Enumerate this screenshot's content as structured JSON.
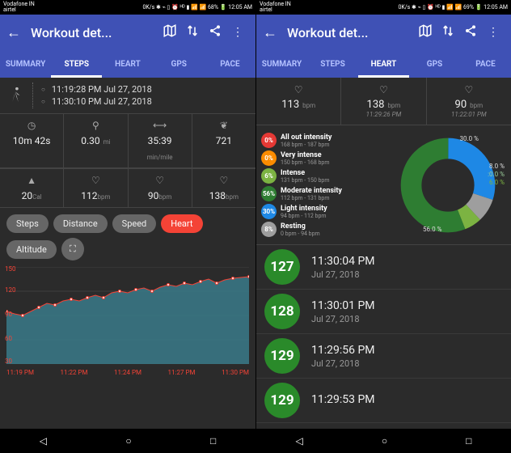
{
  "status": {
    "left_carrier": "Vodafone IN\nairtel",
    "left_icons": "0K/s ✱ ⌁ ▯ ⏰ ᴴᴰ ▮ 📶 📶 68% 🔋 12:05 AM",
    "right_icons": "0K/s ✱ ⌁ ▯ ⏰ ᴴᴰ ▮ 📶 📶 69% 🔋 12:05 AM"
  },
  "appbar": {
    "title": "Workout det...",
    "icons": {
      "map": "⌖",
      "updown": "↑↓",
      "share": "<",
      "more": "⋮"
    }
  },
  "tabs": {
    "items": [
      "SUMMARY",
      "STEPS",
      "HEART",
      "GPS",
      "PACE"
    ],
    "active_left": 1,
    "active_right": 2
  },
  "left": {
    "start_time": "11:19:28 PM Jul 27, 2018",
    "end_time": "11:30:10 PM Jul 27, 2018",
    "stats1": [
      {
        "icon": "⏱",
        "val": "10m 42s",
        "unit": ""
      },
      {
        "icon": "📍",
        "val": "0.30",
        "unit": "mi"
      },
      {
        "icon": "⇔",
        "val": "35:39",
        "unit": "min/mile"
      },
      {
        "icon": "👣",
        "val": "721",
        "unit": ""
      }
    ],
    "stats2": [
      {
        "icon": "🔥",
        "val": "20",
        "unit": "Cal"
      },
      {
        "icon": "♡",
        "val": "112",
        "unit": "bpm"
      },
      {
        "icon": "MIN",
        "val": "90",
        "unit": "bpm"
      },
      {
        "icon": "MAX",
        "val": "138",
        "unit": "bpm"
      }
    ],
    "pills": [
      "Steps",
      "Distance",
      "Speed",
      "Heart",
      "Altitude"
    ],
    "pill_active": 3
  },
  "right": {
    "top": [
      {
        "icon": "♡",
        "val": "113",
        "unit": "bpm",
        "time": ""
      },
      {
        "icon": "MAX",
        "val": "138",
        "unit": "bpm",
        "time": "11:29:26 PM"
      },
      {
        "icon": "MIN",
        "val": "90",
        "unit": "bpm",
        "time": "11:22:01 PM"
      }
    ],
    "zones": [
      {
        "pct": "0%",
        "color": "#e53935",
        "name": "All out intensity",
        "range": "168 bpm - 187 bpm"
      },
      {
        "pct": "0%",
        "color": "#fb8c00",
        "name": "Very intense",
        "range": "150 bpm - 168 bpm"
      },
      {
        "pct": "6%",
        "color": "#7cb342",
        "name": "Intense",
        "range": "131 bpm - 150 bpm"
      },
      {
        "pct": "56%",
        "color": "#2e7d32",
        "name": "Moderate intensity",
        "range": "112 bpm - 131 bpm"
      },
      {
        "pct": "30%",
        "color": "#1e88e5",
        "name": "Light intensity",
        "range": "94 bpm - 112 bpm"
      },
      {
        "pct": "8%",
        "color": "#9e9e9e",
        "name": "Resting",
        "range": "0 bpm - 94 bpm"
      }
    ],
    "donut_labels": {
      "blue": "30.0 %",
      "grey": "8.0 %",
      "ltgreen": ":0.0 %",
      "green": "6.0 %",
      "dkgreen": "56.0 %"
    },
    "readings": [
      {
        "v": "127",
        "t": "11:30:04 PM",
        "d": "Jul 27, 2018"
      },
      {
        "v": "128",
        "t": "11:30:01 PM",
        "d": "Jul 27, 2018"
      },
      {
        "v": "129",
        "t": "11:29:56 PM",
        "d": "Jul 27, 2018"
      },
      {
        "v": "129",
        "t": "11:29:53 PM",
        "d": ""
      }
    ]
  },
  "chart_data": {
    "type": "area",
    "title": "",
    "xlabel": "",
    "ylabel": "",
    "ylim": [
      30,
      150
    ],
    "x_ticks": [
      "11:19 PM",
      "11:22 PM",
      "11:24 PM",
      "11:27 PM",
      "11:30 PM"
    ],
    "y_ticks": [
      30,
      60,
      90,
      120,
      150
    ],
    "series": [
      {
        "name": "Heart",
        "color": "#f44336",
        "values": [
          95,
          92,
          90,
          95,
          100,
          105,
          103,
          108,
          110,
          108,
          112,
          115,
          112,
          118,
          120,
          118,
          122,
          124,
          120,
          125,
          128,
          126,
          130,
          128,
          132,
          135,
          130,
          134,
          136,
          138
        ]
      }
    ]
  }
}
